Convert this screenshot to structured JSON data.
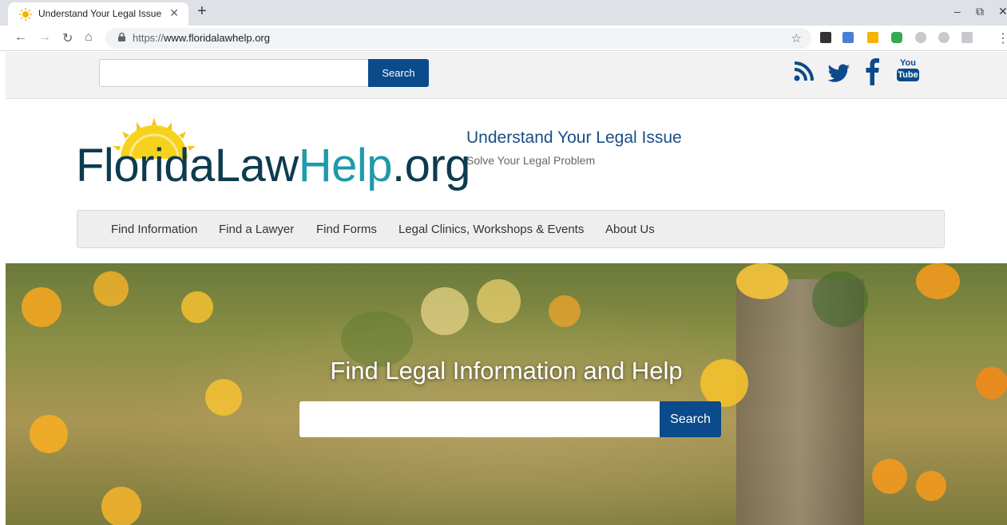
{
  "browser": {
    "tab": {
      "title": "Understand Your Legal Issue",
      "close": "✕",
      "favicon": "sun-favicon-icon"
    },
    "new_tab": "+",
    "window_controls": {
      "minimize": "‒",
      "restore": "⧉",
      "close": "✕"
    },
    "nav": {
      "back": "←",
      "forward": "→",
      "reload": "↻",
      "home": "⌂"
    },
    "address": {
      "scheme": "https://",
      "host": "www.floridalawhelp.org"
    },
    "bookmark_star": "☆",
    "menu": "⋮",
    "extension_icons": [
      "r-extension-icon",
      "translate-extension-icon",
      "yellow-extension-icon",
      "green-extension-icon",
      "gray-extension-icon",
      "gray-extension-icon-2",
      "gray-extension-icon-3"
    ]
  },
  "topbar": {
    "search_button": "Search",
    "social_icons": [
      "rss-icon",
      "twitter-icon",
      "facebook-icon",
      "youtube-icon"
    ],
    "youtube_top": "You",
    "youtube_bottom": "Tube"
  },
  "header": {
    "logo": {
      "part1": "FloridaLaw",
      "part2": "Help",
      "part3": ".org"
    },
    "tagline_title": "Understand Your Legal Issue",
    "tagline_sub": "Solve Your Legal Problem"
  },
  "nav": {
    "items": [
      {
        "label": "Find Information"
      },
      {
        "label": "Find a Lawyer"
      },
      {
        "label": "Find Forms"
      },
      {
        "label": "Legal Clinics, Workshops & Events"
      },
      {
        "label": "About Us"
      }
    ]
  },
  "hero": {
    "title": "Find Legal Information and Help",
    "search_button": "Search"
  },
  "colors": {
    "brand_navy": "#0b4a8b",
    "logo_dark": "#0d3b4f",
    "logo_teal": "#1e9aa8",
    "sun_yellow": "#f5c518"
  }
}
